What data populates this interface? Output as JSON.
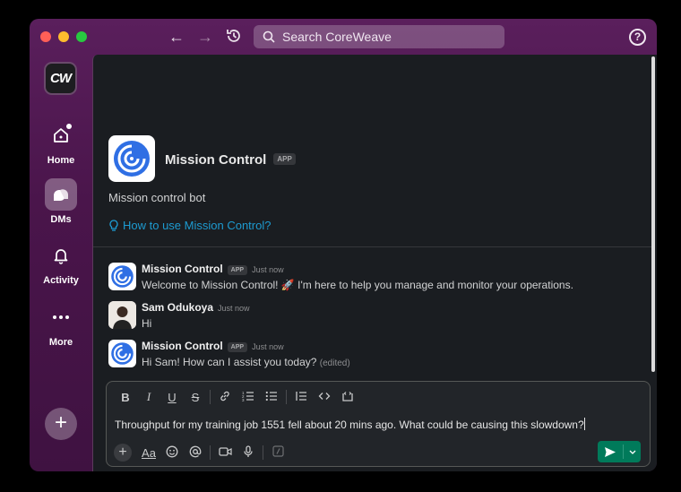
{
  "titlebar": {
    "search_placeholder": "Search CoreWeave",
    "help_label": "?"
  },
  "workspace": {
    "logo_text": "CW"
  },
  "sidebar": {
    "items": [
      {
        "label": "Home",
        "icon": "home-icon"
      },
      {
        "label": "DMs",
        "icon": "dms-icon",
        "active": true
      },
      {
        "label": "Activity",
        "icon": "bell-icon"
      },
      {
        "label": "More",
        "icon": "more-icon"
      }
    ],
    "add_label": "+"
  },
  "intro": {
    "name": "Mission Control",
    "badge": "APP",
    "description": "Mission control bot",
    "link": "How to use Mission Control?"
  },
  "messages": [
    {
      "author": "Mission Control",
      "badge": "APP",
      "time": "Just now",
      "text": "Welcome to Mission Control! 🚀 I'm here to help you manage and monitor your operations."
    },
    {
      "author": "Sam Odukoya",
      "time": "Just now",
      "text": "Hi"
    },
    {
      "author": "Mission Control",
      "badge": "APP",
      "time": "Just now",
      "text": "Hi Sam! How can I assist you today?",
      "edited": "(edited)"
    }
  ],
  "composer": {
    "text": "Throughput for my training job 1551 fell about 20 mins ago. What could be causing this slowdown?",
    "format_buttons": [
      "B",
      "I",
      "U",
      "S"
    ],
    "font_button": "Aa"
  },
  "colors": {
    "sidebar": "#4a154b",
    "main_bg": "#1a1d21",
    "link": "#1d9bd1",
    "send": "#007a5a"
  }
}
